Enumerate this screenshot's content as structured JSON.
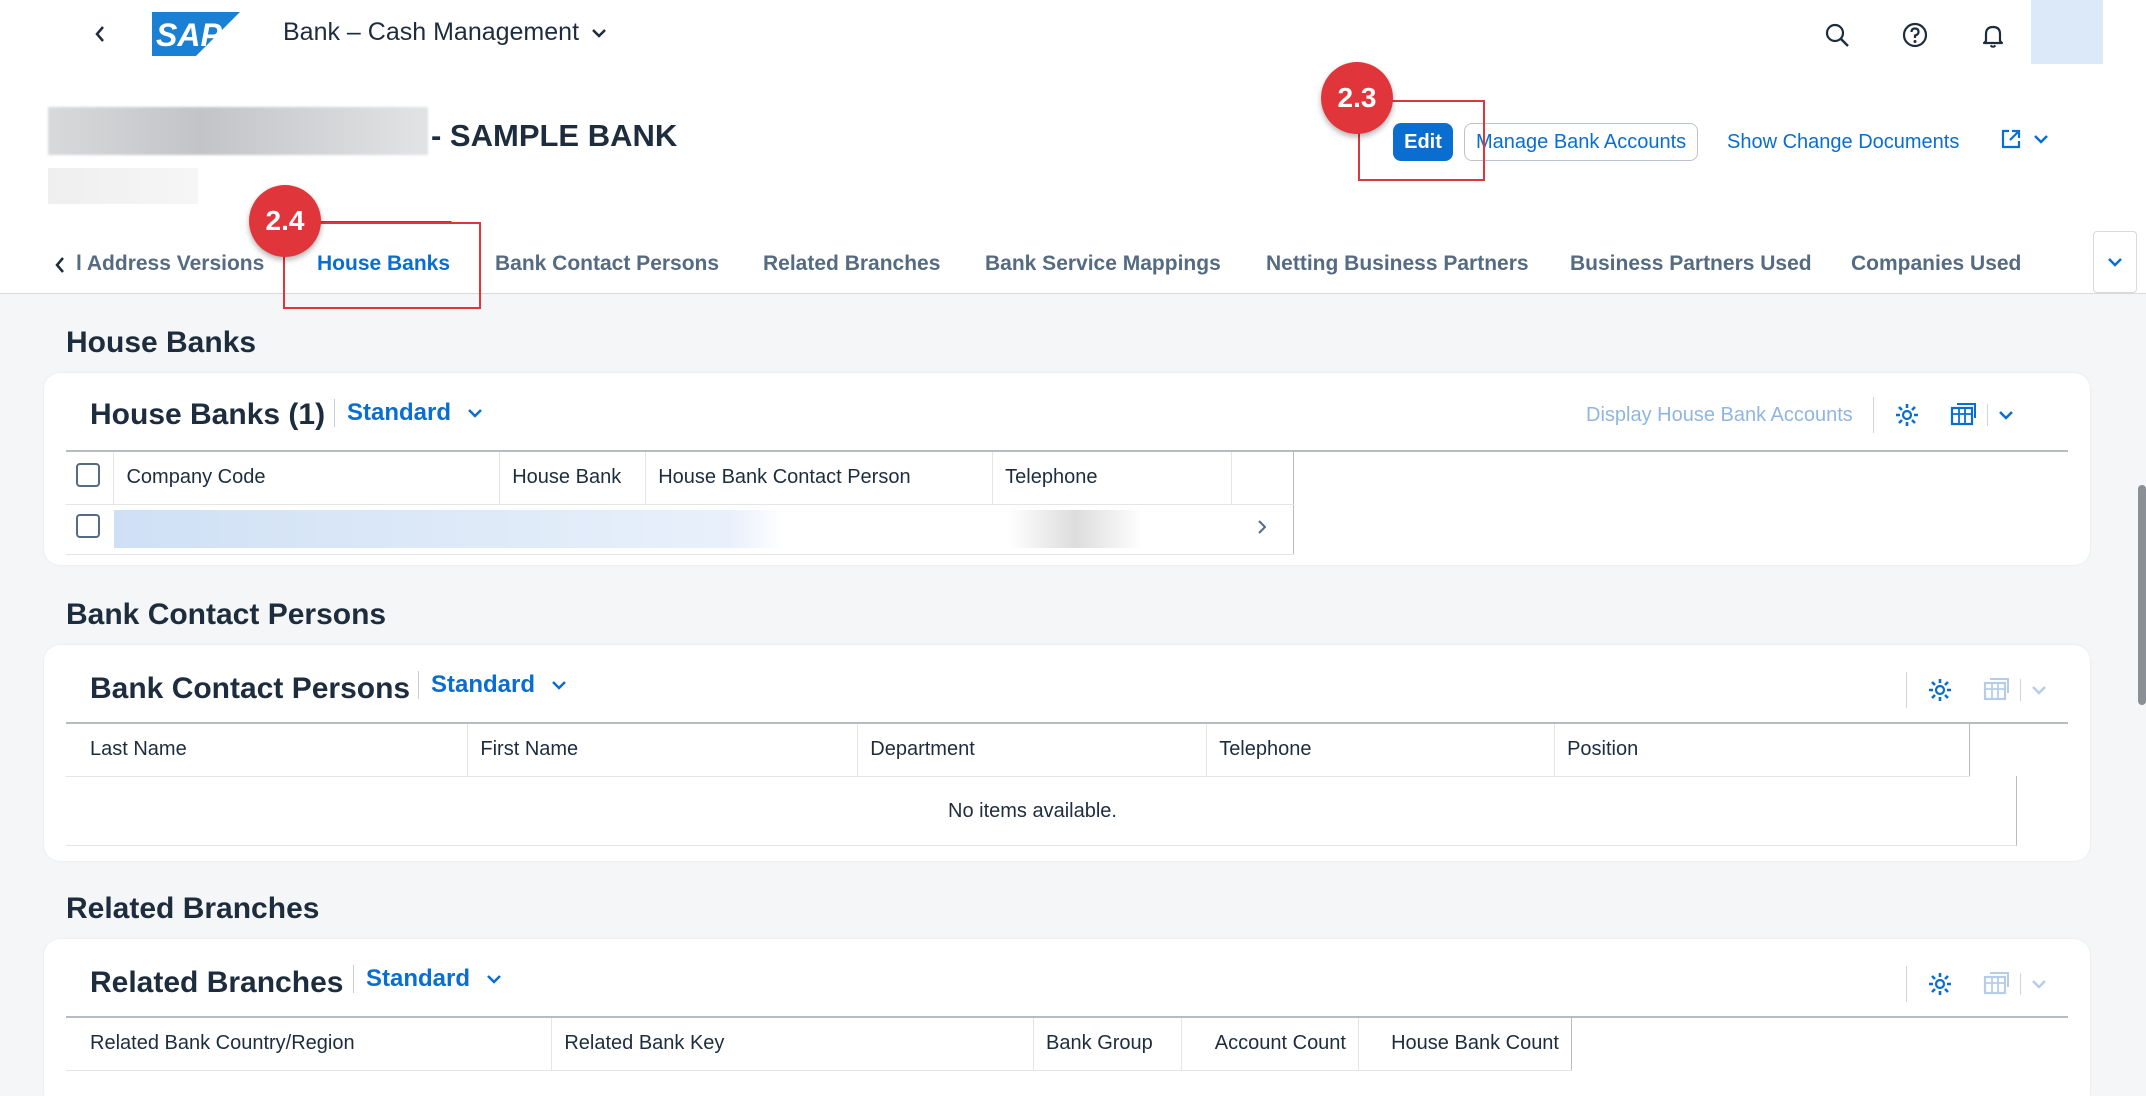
{
  "shell": {
    "logo_text": "SAP",
    "app_title": "Bank – Cash Management"
  },
  "header": {
    "title_suffix": "- SAMPLE BANK",
    "actions": {
      "edit": "Edit",
      "manage": "Manage Bank Accounts",
      "show_changes": "Show Change Documents"
    }
  },
  "annotations": {
    "edit_step": "2.3",
    "tab_step": "2.4"
  },
  "tabs": [
    "l Address Versions",
    "House Banks",
    "Bank Contact Persons",
    "Related Branches",
    "Bank Service Mappings",
    "Netting Business Partners",
    "Business Partners Used",
    "Companies Used"
  ],
  "active_tab": "House Banks",
  "house_banks": {
    "section_title": "House Banks",
    "card_title": "House Banks (1)",
    "variant": "Standard",
    "toolbar_link": "Display House Bank Accounts",
    "columns": [
      "Company Code",
      "House Bank",
      "House Bank Contact Person",
      "Telephone"
    ]
  },
  "contacts": {
    "section_title": "Bank Contact Persons",
    "card_title": "Bank Contact Persons",
    "variant": "Standard",
    "columns": [
      "Last Name",
      "First Name",
      "Department",
      "Telephone",
      "Position"
    ],
    "empty": "No items available."
  },
  "branches": {
    "section_title": "Related Branches",
    "card_title": "Related Branches",
    "variant": "Standard",
    "columns": [
      "Related Bank Country/Region",
      "Related Bank Key",
      "Bank Group",
      "Account Count",
      "House Bank Count"
    ]
  },
  "colors": {
    "accent": "#0a6ed1",
    "annotation": "#e0363b",
    "sap_blue": "#1a80d3"
  }
}
